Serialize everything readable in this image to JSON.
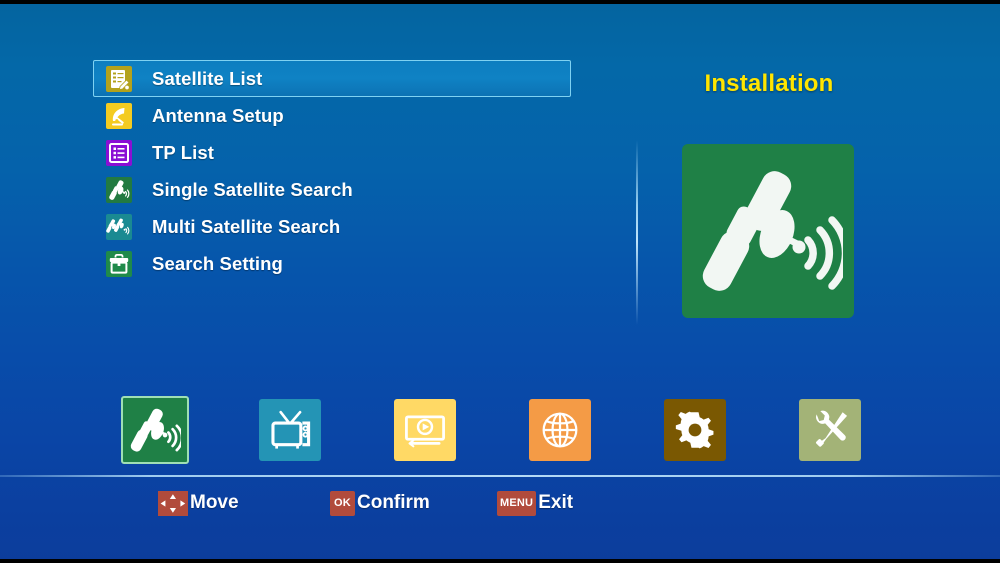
{
  "screen": {
    "background_top_color": "#04649f",
    "background_bottom_color": "#0c3d9c"
  },
  "menu": {
    "items": [
      {
        "label": "Satellite List",
        "icon": "document-edit-icon",
        "icon_bg": "#b3a21c",
        "selected": true
      },
      {
        "label": "Antenna Setup",
        "icon": "satellite-dish-icon",
        "icon_bg": "#f4cb21",
        "selected": false
      },
      {
        "label": "TP List",
        "icon": "list-icon",
        "icon_bg": "#8a0fd4",
        "selected": false
      },
      {
        "label": "Single Satellite Search",
        "icon": "satellite-signal-icon",
        "icon_bg": "#227a41",
        "selected": false
      },
      {
        "label": "Multi Satellite Search",
        "icon": "multi-satellite-icon",
        "icon_bg": "#1a8a92",
        "selected": false
      },
      {
        "label": "Search Setting",
        "icon": "toolbox-icon",
        "icon_bg": "#1f8a4a",
        "selected": false
      }
    ]
  },
  "panel": {
    "title": "Installation",
    "title_color": "#ffe500",
    "graphic_icon": "satellite-signal-icon",
    "graphic_bg": "#1f8046"
  },
  "icon_bar": {
    "items": [
      {
        "name": "installation",
        "icon": "satellite-signal-icon",
        "bg": "#1f8046",
        "selected": true
      },
      {
        "name": "tv-channels",
        "icon": "television-icon",
        "bg": "#2494b5",
        "selected": false
      },
      {
        "name": "media-player",
        "icon": "media-play-icon",
        "bg": "#ffd965",
        "selected": false
      },
      {
        "name": "network",
        "icon": "globe-icon",
        "bg": "#f49b46",
        "selected": false
      },
      {
        "name": "settings",
        "icon": "gear-icon",
        "bg": "#7a5802",
        "selected": false
      },
      {
        "name": "tools",
        "icon": "tools-icon",
        "bg": "#a3b377",
        "selected": false
      }
    ]
  },
  "footer": {
    "hints": [
      {
        "key": "",
        "key_icon": "dpad-arrows-icon",
        "label": "Move"
      },
      {
        "key": "OK",
        "key_icon": "",
        "label": "Confirm"
      },
      {
        "key": "MENU",
        "key_icon": "",
        "label": "Exit"
      }
    ],
    "badge_color": "#b14b3c"
  }
}
